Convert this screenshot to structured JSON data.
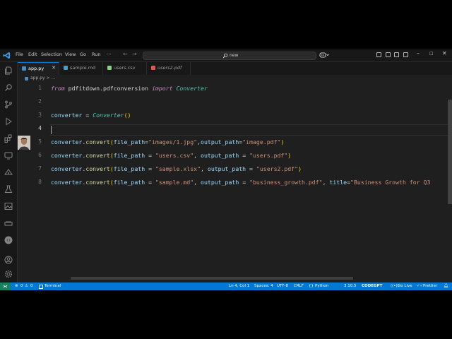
{
  "menu": [
    "File",
    "Edit",
    "Selection",
    "View",
    "Go",
    "Run",
    "···"
  ],
  "search": {
    "text": "new"
  },
  "tabs": [
    {
      "label": "app.py",
      "color": "#4b8bbe",
      "active": true
    },
    {
      "label": "sample.md",
      "color": "#519aba",
      "active": false
    },
    {
      "label": "users.csv",
      "color": "#89d185",
      "active": false
    },
    {
      "label": "users2.pdf",
      "color": "#e05555",
      "active": false
    }
  ],
  "breadcrumb": "app.py > ...",
  "editor": {
    "lines": [
      "1",
      "2",
      "3",
      "4",
      "5",
      "6",
      "7",
      "8"
    ],
    "current_line": "4",
    "code": {
      "l1": {
        "from": "from",
        "module": "pdfitdown.pdfconversion",
        "import": "import",
        "cls": "Converter"
      },
      "l3": {
        "var": "converter",
        "eq": "=",
        "cls": "Converter",
        "call": "()"
      },
      "l5": {
        "obj": "converter",
        "fn": "convert",
        "k1": "file_path",
        "v1": "\"images/1.jpg\"",
        "k2": "output_path",
        "v2": "\"image.pdf\""
      },
      "l6": {
        "obj": "converter",
        "fn": "convert",
        "k1": "file_path",
        "v1": "\"users.csv\"",
        "k2": "output_path",
        "v2": "\"users.pdf\""
      },
      "l7": {
        "obj": "converter",
        "fn": "convert",
        "k1": "file_path",
        "v1": "\"sample.xlsx\"",
        "k2": "output_path",
        "v2": "\"users2.pdf\""
      },
      "l8": {
        "obj": "converter",
        "fn": "convert",
        "k1": "file_path",
        "v1": "\"sample.md\"",
        "k2": "output_path",
        "v2": "\"business_growth.pdf\"",
        "k3": "title",
        "v3": "\"Business Growth for Q3"
      }
    }
  },
  "status": {
    "errors": "0",
    "warnings": "0",
    "terminal": "Terminal",
    "position": "Ln 4, Col 1",
    "spaces": "Spaces: 4",
    "encoding": "UTF-8",
    "eol": "CRLF",
    "language": "Python",
    "version": "3.10.5",
    "codegpt": "CODEGPT",
    "golive": "Go Live",
    "prettier": "Prettier"
  },
  "colors": {
    "accent": "#0078d4",
    "remote": "#16825d",
    "keyword": "#c586c0",
    "class": "#4ec9b0",
    "string": "#ce9178"
  }
}
